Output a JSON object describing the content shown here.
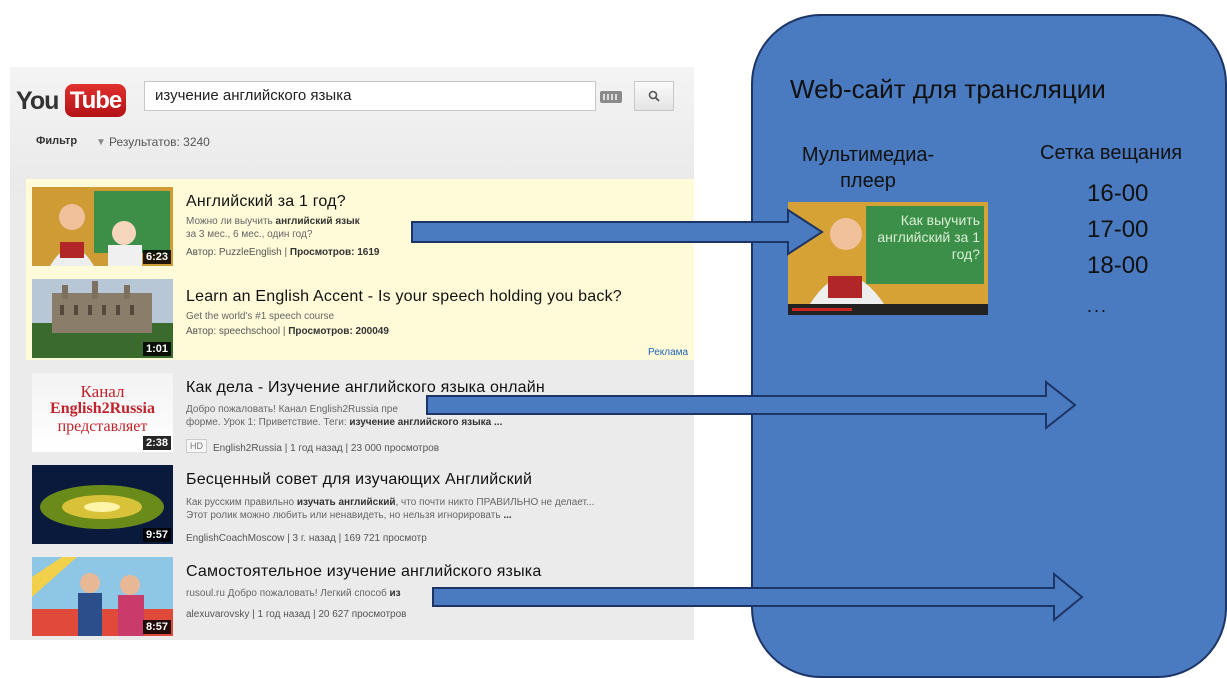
{
  "youtube": {
    "logo_you": "You",
    "logo_tube": "Tube",
    "search_query": "изучение английского языка",
    "search_icon": "magnifier-icon",
    "keyboard_icon": "keyboard-icon",
    "filter_label": "Фильтр",
    "results_label": "Результатов: 3240",
    "ad_label": "Реклама",
    "results": [
      {
        "title": "Английский за 1 год?",
        "desc1_pre": "Можно ли выучить ",
        "desc1_bold": "английский язык",
        "desc2": "за 3 мес., 6 мес., один год?",
        "meta_pre": "Автор: PuzzleEnglish | ",
        "meta_bold": "Просмотров: 1619",
        "duration": "6:23"
      },
      {
        "title": "Learn an English Accent - Is your speech holding you back?",
        "desc1": "Get the world's #1 speech course",
        "meta_pre": "Автор: speechschool | ",
        "meta_bold": "Просмотров: 200049",
        "duration": "1:01"
      },
      {
        "title": "Как дела - Изучение английского языка онлайн",
        "desc1": "Добро пожаловать! Канал English2Russia пре",
        "desc2_pre": "форме. Урок 1: Приветствие. Теги: ",
        "desc2_bold": "изучение английского языка ...",
        "hd": "HD",
        "meta": "English2Russia | 1 год назад | 23 000 просмотров",
        "duration": "2:38",
        "thumb_line1": "Канал",
        "thumb_line2": "English2Russia",
        "thumb_line3": "представляет"
      },
      {
        "title": "Бесценный совет для изучающих Английский",
        "desc1_pre": "Как русским правильно ",
        "desc1_bold": "изучать английский",
        "desc1_post": ", что почти никто ПРАВИЛЬНО не делает...",
        "desc2_pre": "Этот ролик можно любить или ненавидеть, но нельзя игнорировать ",
        "desc2_bold": "...",
        "meta": "EnglishCoachMoscow | 3 г. назад | 169 721 просмотр",
        "duration": "9:57"
      },
      {
        "title": "Самостоятельное изучение английского языка",
        "desc1_pre": "rusoul.ru Добро пожаловать! Легкий способ ",
        "desc1_bold": "из",
        "meta": "alexuvarovsky | 1 год назад | 20 627 просмотров",
        "duration": "8:57"
      }
    ]
  },
  "panel": {
    "title": "Web-сайт для трансляции",
    "player_label": "Мультимедиа-плеер",
    "player_thumb_text": "Как выучить английский за 1 год?",
    "schedule_label": "Сетка вещания",
    "schedule": [
      "16-00",
      "17-00",
      "18-00"
    ],
    "schedule_more": "..."
  },
  "colors": {
    "panel_fill": "#4a7abf",
    "panel_border": "#1d3566",
    "arrow_fill": "#4a7abf",
    "arrow_stroke": "#1d3566",
    "ad_highlight": "#fffad8"
  }
}
